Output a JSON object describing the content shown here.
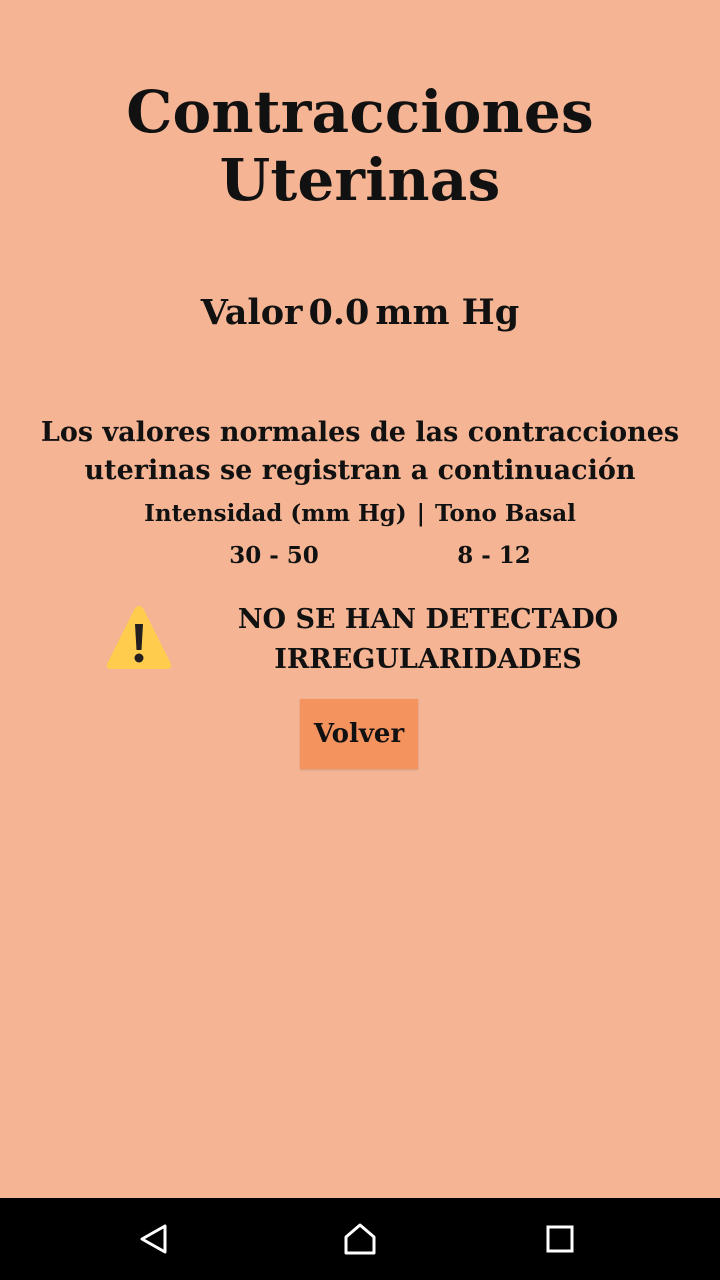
{
  "header": {
    "title": "Contracciones Uterinas"
  },
  "reading": {
    "label": "Valor",
    "value": "0.0",
    "unit": "mm Hg"
  },
  "info": {
    "description": "Los valores normales de las contracciones uterinas se registran a continuación",
    "columns": [
      "Intensidad (mm Hg)",
      "Tono Basal"
    ],
    "separator": "|",
    "ranges": {
      "intensity": "30 - 50",
      "basal_tone": "8 - 12"
    }
  },
  "status": {
    "icon": "warning-icon",
    "line1": "NO SE HAN DETECTADO",
    "line2": "IRREGULARIDADES"
  },
  "actions": {
    "back_label": "Volver"
  },
  "colors": {
    "background": "#F5B594",
    "button": "#F5935F",
    "warning": "#FFCC4D",
    "navbar": "#000000"
  },
  "system_nav": {
    "buttons": [
      "back-icon",
      "home-icon",
      "recents-icon"
    ]
  }
}
